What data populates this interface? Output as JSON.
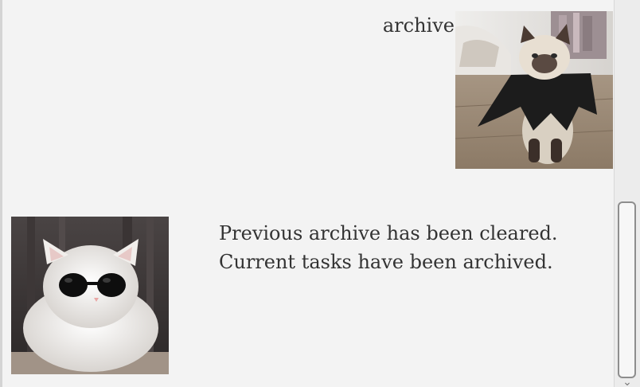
{
  "conversation": {
    "user_message": {
      "text": "archive",
      "image": "cat-in-black-cape-photo"
    },
    "bot_message": {
      "image": "white-cat-with-sunglasses-photo",
      "lines": [
        "Previous archive has been cleared.",
        "Current tasks have been archived."
      ]
    }
  },
  "scrollbar": {
    "down_arrow_icon": "chevron-down-icon",
    "position_fraction": 1.0
  },
  "colors": {
    "background": "#f3f3f3",
    "text": "#333333",
    "scrollbar_track": "#ececec",
    "scrollbar_thumb_border": "#8e8e8e"
  }
}
